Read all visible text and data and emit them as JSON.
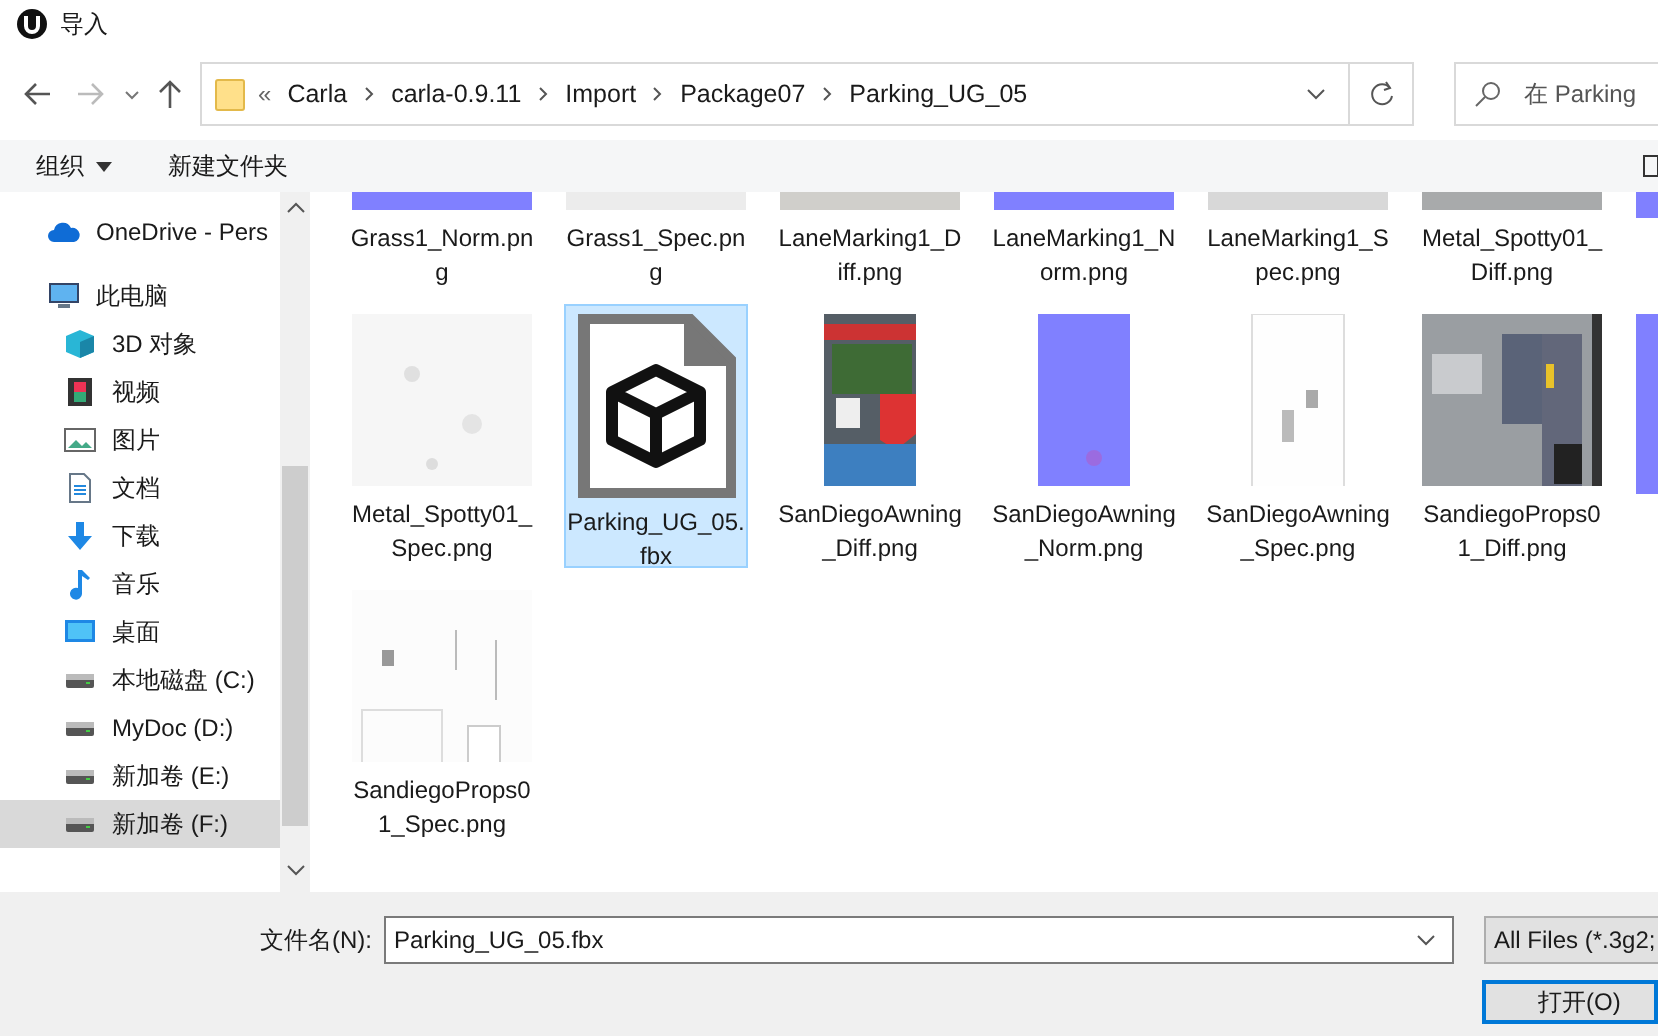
{
  "window": {
    "title": "导入"
  },
  "address": {
    "overflow": "«",
    "crumbs": [
      "Carla",
      "carla-0.9.11",
      "Import",
      "Package07",
      "Parking_UG_05"
    ]
  },
  "search": {
    "placeholder": "在 Parking"
  },
  "toolbar": {
    "organize": "组织",
    "new_folder": "新建文件夹"
  },
  "sidebar": {
    "items": [
      {
        "label": "OneDrive - Pers",
        "kind": "cloud",
        "selected": false
      },
      {
        "label": "此电脑",
        "kind": "pc",
        "selected": false,
        "children": [
          {
            "label": "3D 对象",
            "kind": "cube",
            "selected": false
          },
          {
            "label": "视频",
            "kind": "video",
            "selected": false
          },
          {
            "label": "图片",
            "selected": false
          },
          {
            "label": "文档",
            "kind": "doc",
            "selected": false
          },
          {
            "label": "下载",
            "kind": "download",
            "selected": false
          },
          {
            "label": "音乐",
            "kind": "music",
            "selected": false
          },
          {
            "label": "桌面",
            "kind": "desktop",
            "selected": false
          },
          {
            "label": "本地磁盘 (C:)",
            "kind": "drive",
            "selected": false
          },
          {
            "label": "MyDoc (D:)",
            "kind": "drive",
            "selected": false
          },
          {
            "label": "新加卷 (E:)",
            "kind": "drive",
            "selected": false
          },
          {
            "label": "新加卷 (F:)",
            "kind": "drive",
            "selected": true
          }
        ]
      }
    ]
  },
  "files": [
    {
      "name": "Grass1_Norm.png",
      "kind": "picture",
      "selected": false
    },
    {
      "name": "Grass1_Spec.png",
      "kind": "picture",
      "selected": false
    },
    {
      "name": "LaneMarking1_Diff.png",
      "kind": "picture",
      "selected": false
    },
    {
      "name": "LaneMarking1_Norm.png",
      "kind": "picture",
      "selected": false
    },
    {
      "name": "LaneMarking1_Spec.png",
      "kind": "picture",
      "selected": false
    },
    {
      "name": "Metal_Spotty01_Diff.png",
      "kind": "picture",
      "selected": false
    },
    {
      "kind": "picture",
      "selected": false
    },
    {
      "name": "Metal_Spotty01_Spec.png",
      "kind": "picture",
      "selected": false
    },
    {
      "name": "Parking_UG_05.fbx",
      "kind": "model",
      "selected": true
    },
    {
      "name": "SanDiegoAwning_Diff.png",
      "kind": "picture",
      "selected": false
    },
    {
      "name": "SanDiegoAwning_Norm.png",
      "kind": "picture",
      "selected": false
    },
    {
      "name": "SanDiegoAwning_Spec.png",
      "kind": "picture",
      "selected": false
    },
    {
      "name": "SandiegoProps01_Diff.png",
      "kind": "picture",
      "selected": false
    },
    {
      "kind": "picture",
      "selected": false
    },
    {
      "name": "SandiegoProps01_Spec.png",
      "kind": "picture",
      "selected": false
    }
  ],
  "footer": {
    "filename_label": "文件名(N):",
    "filename": "Parking_UG_05.fbx",
    "filter": "All Files (*.3g2;",
    "open": "打开(O)"
  }
}
